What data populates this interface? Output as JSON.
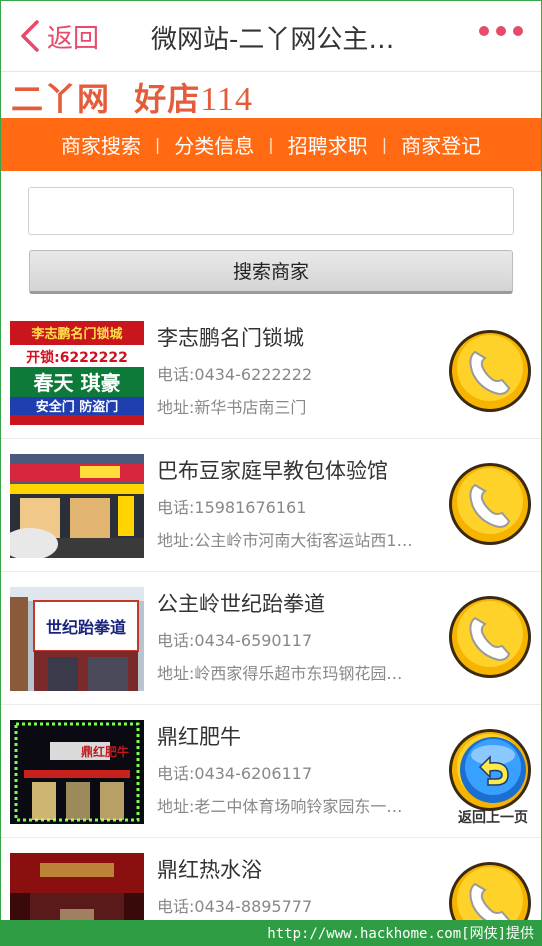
{
  "header": {
    "back_label": "返回",
    "title": "微网站-二丫网公主…"
  },
  "brand": {
    "name": "二丫网",
    "slogan": "好店",
    "number": "114"
  },
  "nav": {
    "items": [
      {
        "label": "商家搜索"
      },
      {
        "label": "分类信息"
      },
      {
        "label": "招聘求职"
      },
      {
        "label": "商家登记"
      }
    ]
  },
  "search": {
    "input_value": "",
    "button_label": "搜索商家"
  },
  "shops": [
    {
      "name": "李志鹏名门锁城",
      "phone": "电话:0434-6222222",
      "address": "地址:新华书店南三门",
      "thumb": {
        "line1": "李志鹏名门锁城",
        "line2": "开锁:6222222",
        "line3": "春天 琪豪",
        "line4": "安全门 防盗门"
      }
    },
    {
      "name": "巴布豆家庭早教包体验馆",
      "phone": "电话:15981676161",
      "address": "地址:公主岭市河南大街客运站西1…"
    },
    {
      "name": "公主岭世纪跆拳道",
      "phone": "电话:0434-6590117",
      "address": "地址:岭西家得乐超市东玛钢花园…",
      "thumb": {
        "line1": "世纪跆拳道"
      }
    },
    {
      "name": "鼎红肥牛",
      "phone": "电话:0434-6206117",
      "address": "地址:老二中体育场响铃家园东一…",
      "thumb": {
        "line1": "鼎红肥牛"
      }
    },
    {
      "name": "鼎红热水浴",
      "phone": "电话:0434-8895777",
      "address": ""
    }
  ],
  "float_back": {
    "label": "返回上一页"
  },
  "footer": {
    "watermark": "http://www.hackhome.com[网侠]提供"
  },
  "colors": {
    "accent_pink": "#e84a6b",
    "nav_orange": "#ff6a12",
    "brand_red": "#e45d3a",
    "call_yellow": "#f6b400",
    "footer_green": "#2f9d44"
  }
}
